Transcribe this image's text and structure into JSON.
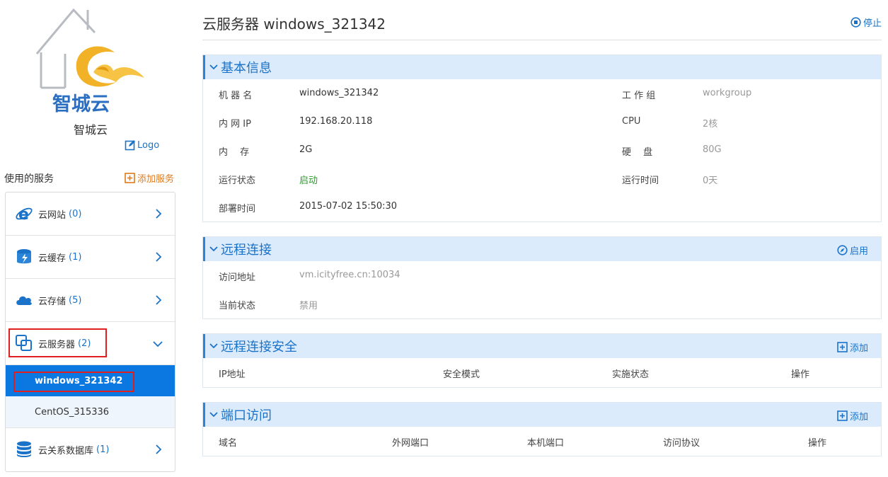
{
  "sidebar": {
    "brand_logo_text": "智城云",
    "brand_name": "智城云",
    "logo_edit_label": "Logo",
    "services_label": "使用的服务",
    "add_service_label": "添加服务",
    "items": [
      {
        "label": "云网站",
        "count": "(0)",
        "icon": "ie-icon"
      },
      {
        "label": "云缓存",
        "count": "(1)",
        "icon": "cache-icon"
      },
      {
        "label": "云存储",
        "count": "(5)",
        "icon": "cloud-icon"
      },
      {
        "label": "云服务器",
        "count": "(2)",
        "icon": "server-icon"
      },
      {
        "label": "云关系数据库",
        "count": "(1)",
        "icon": "database-icon"
      }
    ],
    "sub_items": [
      {
        "label": "windows_321342",
        "active": true
      },
      {
        "label": "CentOS_315336",
        "active": false
      }
    ]
  },
  "header": {
    "title": "云服务器 windows_321342",
    "stop_label": "停止"
  },
  "basic_info": {
    "title": "基本信息",
    "machine_name_label": "机 器 名",
    "machine_name": "windows_321342",
    "workgroup_label": "工 作 组",
    "workgroup": "workgroup",
    "ip_label": "内 网 IP",
    "ip": "192.168.20.118",
    "cpu_label": "CPU",
    "cpu": "2核",
    "memory_label": "内　 存",
    "memory": "2G",
    "disk_label": "硬　 盘",
    "disk": "80G",
    "status_label": "运行状态",
    "status": "启动",
    "uptime_label": "运行时间",
    "uptime": "0天",
    "deploy_label": "部署时间",
    "deploy_time": "2015-07-02 15:50:30"
  },
  "remote": {
    "title": "远程连接",
    "enable_label": "启用",
    "address_label": "访问地址",
    "address": "vm.icityfree.cn:10034",
    "state_label": "当前状态",
    "state": "禁用"
  },
  "remote_security": {
    "title": "远程连接安全",
    "add_label": "添加",
    "columns": [
      "IP地址",
      "安全模式",
      "实施状态",
      "操作"
    ]
  },
  "port_access": {
    "title": "端口访问",
    "add_label": "添加",
    "columns": [
      "域名",
      "外网端口",
      "本机端口",
      "访问协议",
      "操作"
    ]
  },
  "colors": {
    "accent": "#1a73c9",
    "active_bg": "#0a78e0",
    "section_bg": "#dcebfb",
    "orange": "#e07a1b",
    "green": "#2a9a2a",
    "highlight": "#e02020"
  }
}
